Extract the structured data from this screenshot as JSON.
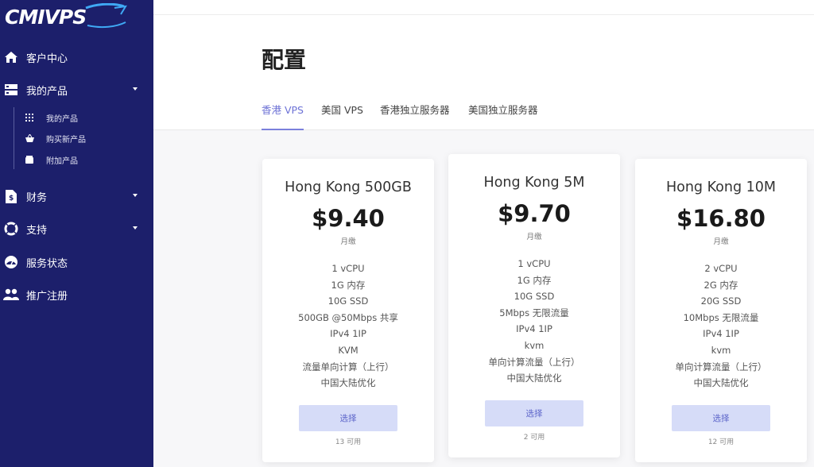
{
  "brand": {
    "logo_text": "CMIVPS"
  },
  "sidebar": {
    "items": [
      {
        "label": "客户中心",
        "icon": "home-icon"
      },
      {
        "label": "我的产品",
        "icon": "server-icon"
      },
      {
        "label": "财务",
        "icon": "invoice-icon"
      },
      {
        "label": "支持",
        "icon": "lifebuoy-icon"
      },
      {
        "label": "服务状态",
        "icon": "gauge-icon"
      },
      {
        "label": "推广注册",
        "icon": "users-icon"
      }
    ],
    "subitems": [
      {
        "label": "我的产品",
        "icon": "grid-icon"
      },
      {
        "label": "购买新产品",
        "icon": "basket-icon"
      },
      {
        "label": "附加产品",
        "icon": "box-icon"
      }
    ]
  },
  "page": {
    "title": "配置",
    "tabs": [
      {
        "label": "香港 VPS",
        "active": true
      },
      {
        "label": "美国 VPS",
        "active": false
      },
      {
        "label": "香港独立服务器",
        "active": false
      },
      {
        "label": "美国独立服务器",
        "active": false
      }
    ]
  },
  "products": [
    {
      "name": "Hong Kong 500GB",
      "price": "$9.40",
      "cycle": "月缴",
      "features": [
        "1 vCPU",
        "1G 内存",
        "10G SSD",
        "500GB @50Mbps 共享",
        "IPv4 1IP",
        "KVM",
        "流量单向计算（上行）",
        "中国大陆优化"
      ],
      "button": "选择",
      "availability": "13 可用"
    },
    {
      "name": "Hong Kong 5M",
      "price": "$9.70",
      "cycle": "月缴",
      "features": [
        "1 vCPU",
        "1G 内存",
        "10G SSD",
        "5Mbps 无限流量",
        "IPv4 1IP",
        "kvm",
        "单向计算流量（上行）",
        "中国大陆优化"
      ],
      "button": "选择",
      "availability": "2 可用"
    },
    {
      "name": "Hong Kong 10M",
      "price": "$16.80",
      "cycle": "月缴",
      "features": [
        "2 vCPU",
        "2G 内存",
        "20G SSD",
        "10Mbps 无限流量",
        "IPv4 1IP",
        "kvm",
        "单向计算流量（上行）",
        "中国大陆优化"
      ],
      "button": "选择",
      "availability": "12 可用"
    }
  ],
  "colors": {
    "sidebar_bg": "#1c1f6b",
    "accent": "#6d72d6",
    "button_bg": "#d6dcf8",
    "logo_accent": "#3fa9f5"
  }
}
